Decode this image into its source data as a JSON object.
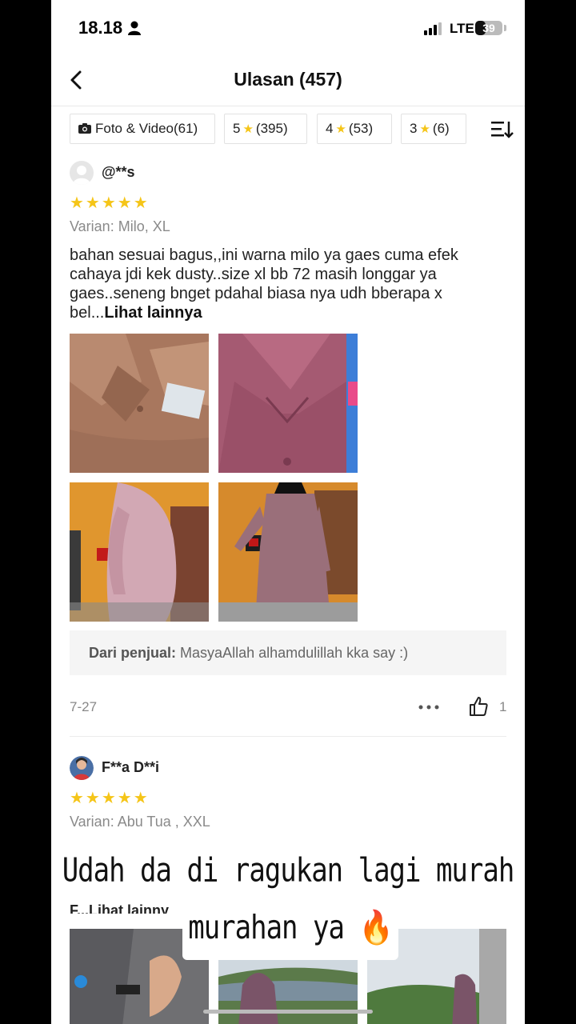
{
  "status_bar": {
    "time": "18.18",
    "network": "LTE",
    "battery": "39",
    "battery_level_percent": 39
  },
  "header": {
    "title": "Ulasan (457)"
  },
  "filters": {
    "chips": [
      {
        "label": "Foto & Video",
        "count": "(61)",
        "icon": "camera-icon"
      },
      {
        "label": "5",
        "count": "(395)"
      },
      {
        "label": "4",
        "count": "(53)"
      },
      {
        "label": "3",
        "count": "(6)"
      }
    ],
    "sort_icon": "sort-icon"
  },
  "reviews": [
    {
      "user": "@**s",
      "stars": "★★★★★",
      "rating": 5,
      "variant": "Varian: Milo, XL",
      "text": "bahan sesuai bagus,,ini warna milo ya gaes cuma efek cahaya jdi kek dusty..size xl bb 72 masih longgar ya gaes..seneng bnget pdahal biasa nya udh bberapa x bel...",
      "see_more": "Lihat lainnya",
      "seller_label": "Dari penjual:",
      "seller_reply": "MasyaAllah alhamdulillah kka say :)",
      "date": "7-27",
      "likes": "1"
    },
    {
      "user": "F**a D**i",
      "stars": "★★★★★",
      "rating": 5,
      "variant": "Varian: Abu Tua , XXL",
      "partial_text": "F...Lihat lainny"
    }
  ],
  "overlay": {
    "line1": "Udah da di ragukan lagi murah tapi ga",
    "line2": "murahan ya 🔥"
  },
  "colors": {
    "star": "#f5c518",
    "text": "#222222",
    "muted": "#888888",
    "seller_bg": "#f5f5f5"
  }
}
